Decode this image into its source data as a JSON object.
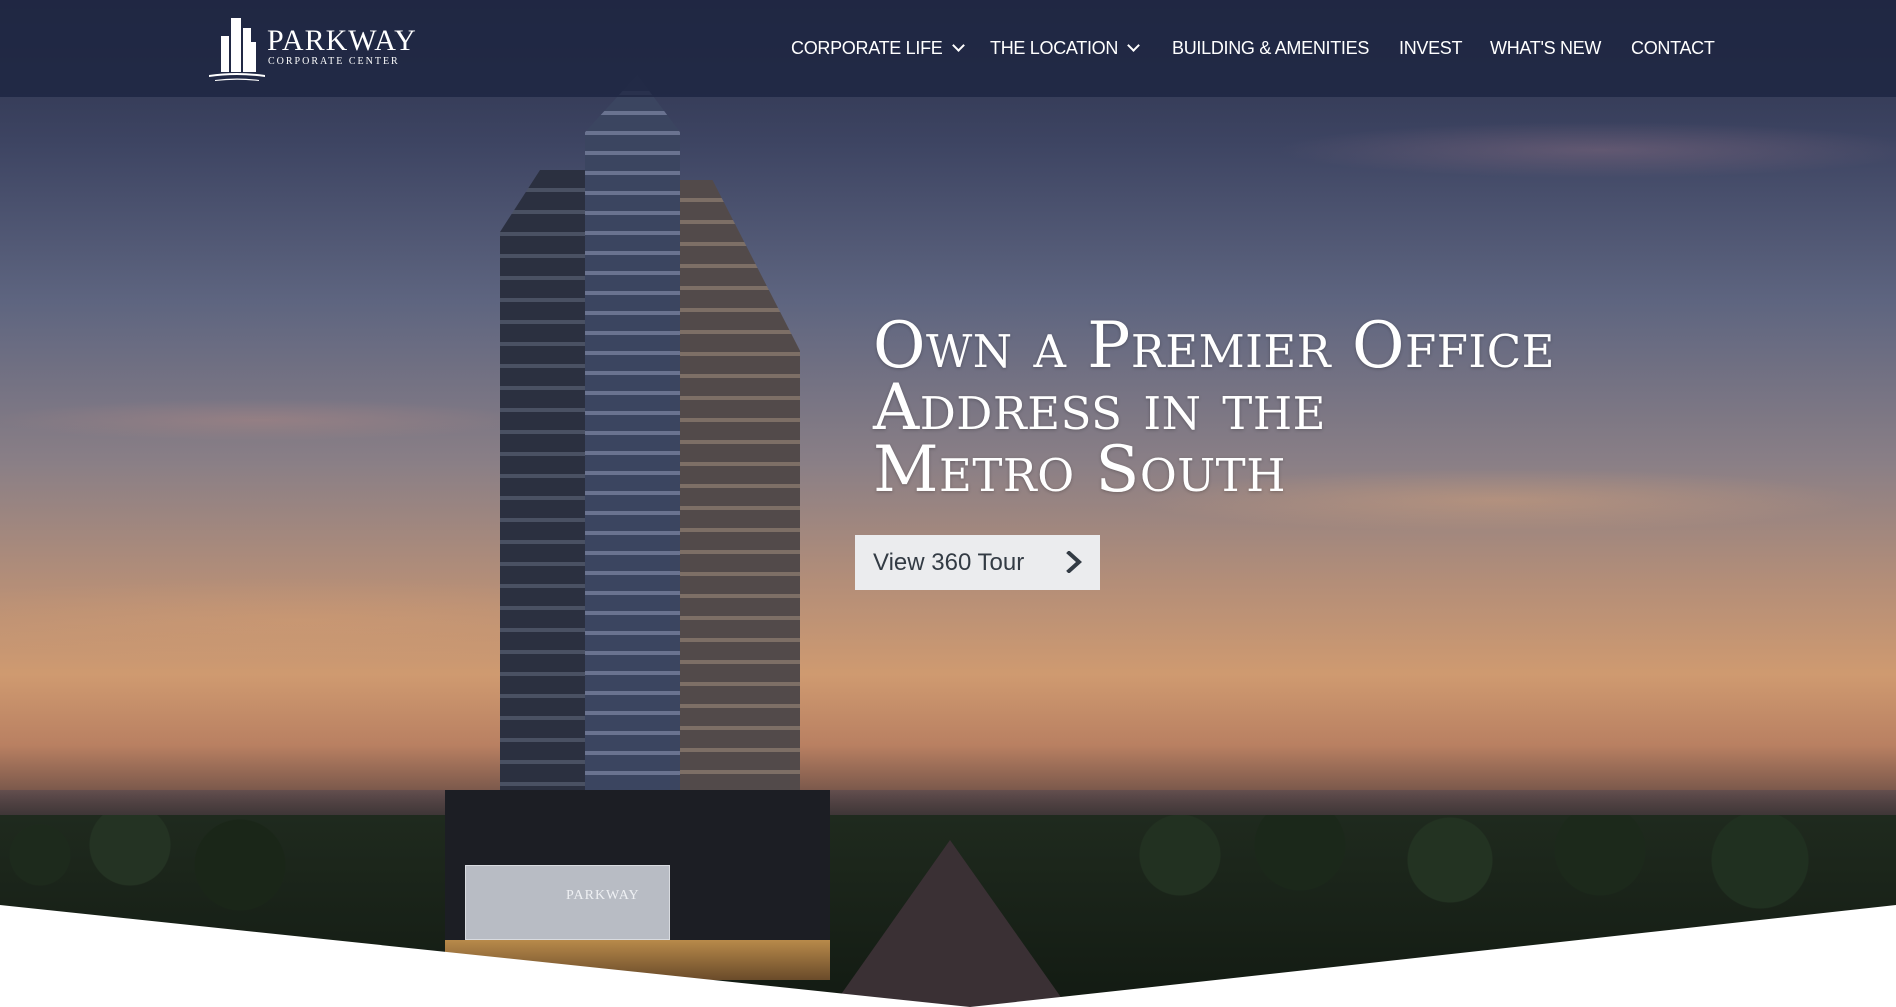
{
  "brand": {
    "name": "PARKWAY",
    "subtitle": "CORPORATE CENTER",
    "sign_text": "PARKWAY"
  },
  "nav": {
    "items": [
      {
        "label": "CORPORATE LIFE",
        "dropdown": true
      },
      {
        "label": "THE LOCATION",
        "dropdown": true
      },
      {
        "label": "BUILDING & AMENITIES",
        "dropdown": false
      },
      {
        "label": "INVEST",
        "dropdown": false
      },
      {
        "label": "WHAT'S NEW",
        "dropdown": false
      },
      {
        "label": "CONTACT",
        "dropdown": false
      }
    ]
  },
  "hero": {
    "headline_lines": [
      "Own a Premier Office",
      "Address in the",
      "Metro South"
    ],
    "cta_label": "View 360 Tour",
    "cta_icon": "chevron-right-icon"
  },
  "colors": {
    "navbar": "#1e2642",
    "cta_background": "#ebecee",
    "cta_text": "#333b44"
  }
}
